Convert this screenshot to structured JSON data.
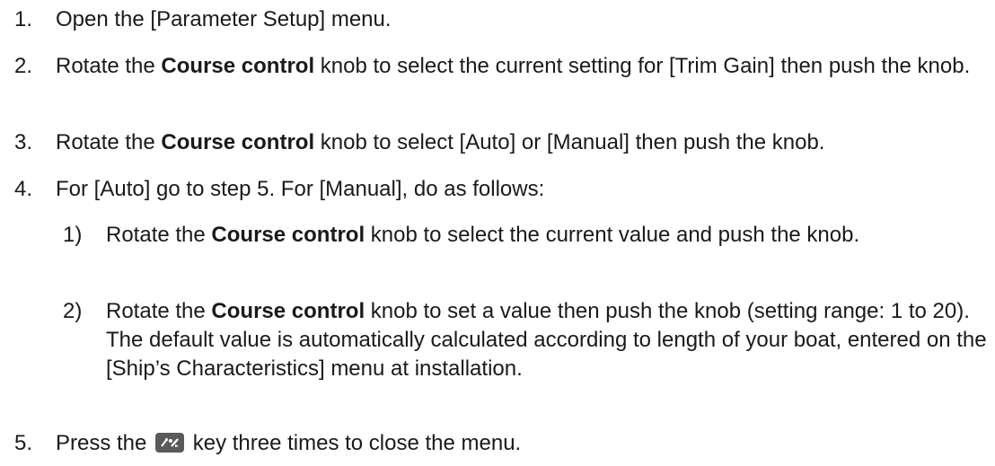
{
  "steps": [
    {
      "number": "1.",
      "text": "Open the [Parameter Setup] menu."
    },
    {
      "number": "2.",
      "pre": "Rotate the ",
      "bold": "Course control",
      "post": " knob to select the current setting for [Trim Gain] then push the knob."
    },
    {
      "number": "3.",
      "pre": "Rotate the ",
      "bold": "Course control",
      "post": " knob to select [Auto] or [Manual] then push the knob."
    },
    {
      "number": "4.",
      "text": "For [Auto] go to step 5. For [Manual], do as follows:",
      "substeps": [
        {
          "number": "1)",
          "pre": "Rotate the ",
          "bold": "Course control",
          "post": " knob to select the current value and push the knob."
        },
        {
          "number": "2)",
          "pre": "Rotate the ",
          "bold": "Course control",
          "post": " knob to set a value then push the knob (setting range: 1 to 20).",
          "note": "The default value is automatically calculated according to length of your boat, entered on the [Ship’s Characteristics] menu at installation."
        }
      ]
    },
    {
      "number": "5.",
      "pre": "Press the ",
      "icon": "menu-escape-key-icon",
      "post": " key three times to close the menu."
    }
  ],
  "colors": {
    "text": "#1a1a1a",
    "key_icon_bg": "#5a5a5a",
    "key_icon_fg": "#ffffff"
  }
}
